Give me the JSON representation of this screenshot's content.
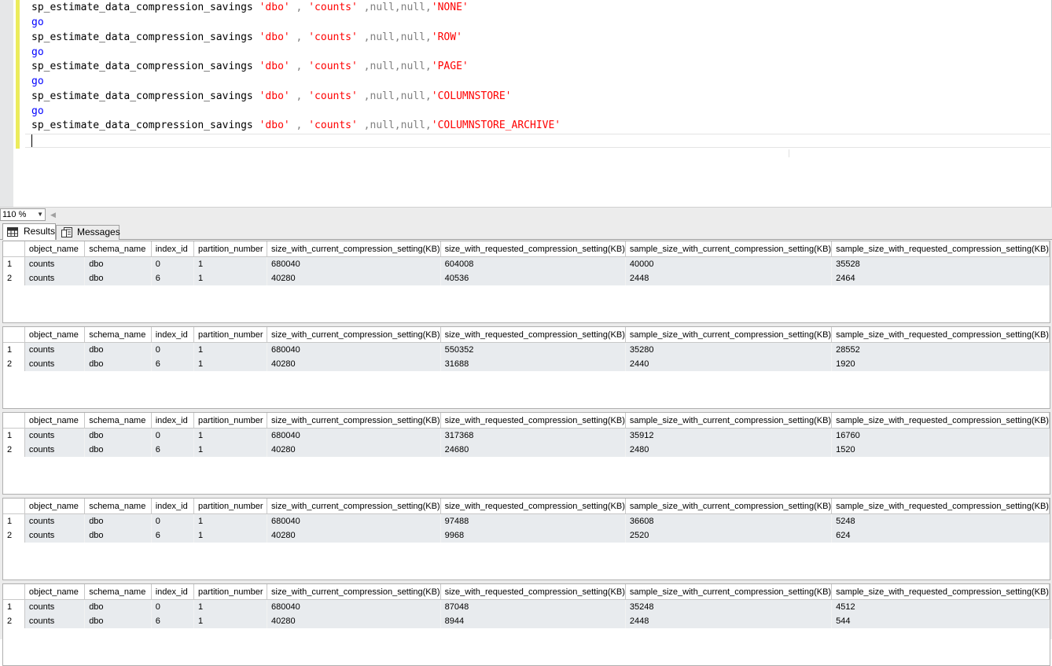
{
  "editor": {
    "lines": [
      {
        "proc": "sp_estimate_data_compression_savings",
        "schema": "'dbo'",
        "sep1": " , ",
        "table": "'counts'",
        "mid": " ,null,null,",
        "type": "'NONE'"
      },
      {
        "go": "go"
      },
      {
        "proc": "sp_estimate_data_compression_savings",
        "schema": "'dbo'",
        "sep1": " , ",
        "table": "'counts'",
        "mid": " ,null,null,",
        "type": "'ROW'"
      },
      {
        "go": "go"
      },
      {
        "proc": "sp_estimate_data_compression_savings",
        "schema": "'dbo'",
        "sep1": " , ",
        "table": "'counts'",
        "mid": " ,null,null,",
        "type": "'PAGE'"
      },
      {
        "go": "go"
      },
      {
        "proc": "sp_estimate_data_compression_savings",
        "schema": "'dbo'",
        "sep1": " , ",
        "table": "'counts'",
        "mid": " ,null,null,",
        "type": "'COLUMNSTORE'"
      },
      {
        "go": "go"
      },
      {
        "proc": "sp_estimate_data_compression_savings",
        "schema": "'dbo'",
        "sep1": " , ",
        "table": "'counts'",
        "mid": " ,null,null,",
        "type": "'COLUMNSTORE_ARCHIVE'"
      }
    ],
    "colors": {
      "keyword": "#0000ff",
      "string": "#ff0000",
      "operator": "#808080",
      "changebar": "#ecec5c"
    }
  },
  "zoom": {
    "value": "110 %"
  },
  "tabs": {
    "results": "Results",
    "messages": "Messages",
    "results_icon": "grid-icon",
    "messages_icon": "messages-icon"
  },
  "columns": [
    "object_name",
    "schema_name",
    "index_id",
    "partition_number",
    "size_with_current_compression_setting(KB)",
    "size_with_requested_compression_setting(KB)",
    "sample_size_with_current_compression_setting(KB)",
    "sample_size_with_requested_compression_setting(KB)"
  ],
  "grids": [
    {
      "rows": [
        {
          "n": "1",
          "cells": [
            "counts",
            "dbo",
            "0",
            "1",
            "680040",
            "604008",
            "40000",
            "35528"
          ]
        },
        {
          "n": "2",
          "cells": [
            "counts",
            "dbo",
            "6",
            "1",
            "40280",
            "40536",
            "2448",
            "2464"
          ]
        }
      ]
    },
    {
      "rows": [
        {
          "n": "1",
          "cells": [
            "counts",
            "dbo",
            "0",
            "1",
            "680040",
            "550352",
            "35280",
            "28552"
          ]
        },
        {
          "n": "2",
          "cells": [
            "counts",
            "dbo",
            "6",
            "1",
            "40280",
            "31688",
            "2440",
            "1920"
          ]
        }
      ]
    },
    {
      "rows": [
        {
          "n": "1",
          "cells": [
            "counts",
            "dbo",
            "0",
            "1",
            "680040",
            "317368",
            "35912",
            "16760"
          ]
        },
        {
          "n": "2",
          "cells": [
            "counts",
            "dbo",
            "6",
            "1",
            "40280",
            "24680",
            "2480",
            "1520"
          ]
        }
      ]
    },
    {
      "rows": [
        {
          "n": "1",
          "cells": [
            "counts",
            "dbo",
            "0",
            "1",
            "680040",
            "97488",
            "36608",
            "5248"
          ]
        },
        {
          "n": "2",
          "cells": [
            "counts",
            "dbo",
            "6",
            "1",
            "40280",
            "9968",
            "2520",
            "624"
          ]
        }
      ]
    },
    {
      "rows": [
        {
          "n": "1",
          "cells": [
            "counts",
            "dbo",
            "0",
            "1",
            "680040",
            "87048",
            "35248",
            "4512"
          ]
        },
        {
          "n": "2",
          "cells": [
            "counts",
            "dbo",
            "6",
            "1",
            "40280",
            "8944",
            "2448",
            "544"
          ]
        }
      ]
    }
  ]
}
